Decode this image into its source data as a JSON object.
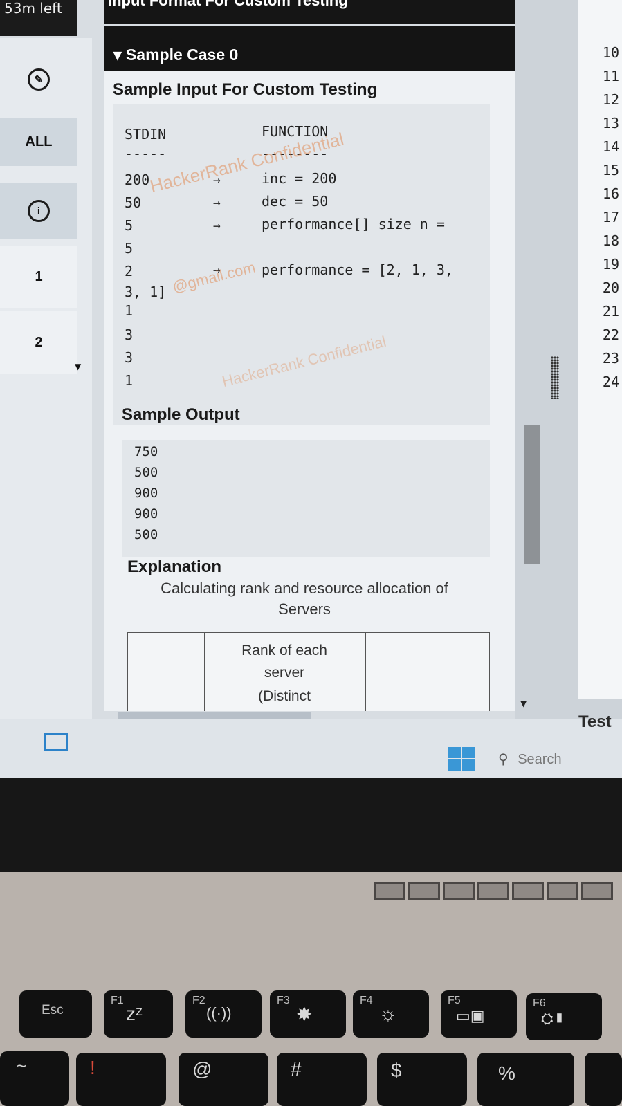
{
  "timer": {
    "label": "53m left"
  },
  "left_nav": {
    "items": [
      {
        "label": "ALL"
      },
      {
        "label": "1"
      },
      {
        "label": "2"
      }
    ]
  },
  "top_strip": {
    "text": "Input Format For Custom Testing"
  },
  "sample_case": {
    "header": "▾ Sample Case 0",
    "input_title": "Sample Input For Custom Testing",
    "stdin_header": "STDIN",
    "function_header": "FUNCTION",
    "stdin_rule": "-----",
    "function_rule": "--------",
    "stdin_lines": [
      "200",
      "50",
      "5",
      "5",
      "2",
      "3, 1]",
      "1",
      "3",
      "3",
      "1"
    ],
    "arrow": "→",
    "function_lines": [
      "inc = 200",
      "dec = 50",
      "performance[] size n =",
      "performance = [2, 1, 3,"
    ],
    "output_title": "Sample Output",
    "output_lines": [
      "750",
      "500",
      "900",
      "900",
      "500"
    ],
    "explanation_title": "Explanation",
    "explanation_line1": "Calculating rank and resource allocation of",
    "explanation_line2": "Servers",
    "table_header_lines": [
      "Rank of each",
      "server",
      "(Distinct"
    ]
  },
  "watermarks": {
    "wm1": "HackerRank Confidential",
    "wm2": "@gmail.com",
    "wm3": "HackerRank Confidential"
  },
  "editor": {
    "line_numbers": [
      "10",
      "11",
      "12",
      "13",
      "14",
      "15",
      "16",
      "17",
      "18",
      "19",
      "20",
      "21",
      "22",
      "23",
      "24"
    ],
    "test_button": "Test"
  },
  "taskbar": {
    "search_placeholder": "Search"
  },
  "keyboard": {
    "esc": "Esc",
    "f1": "F1",
    "f2": "F2",
    "f3": "F3",
    "f4": "F4",
    "f5": "F5",
    "f6": "F6",
    "row2": [
      "!",
      "@",
      "#",
      "$",
      "%"
    ]
  },
  "colors": {
    "accent": "#141414",
    "watermark": "#e07a3a",
    "windows": "#3a97d6"
  }
}
